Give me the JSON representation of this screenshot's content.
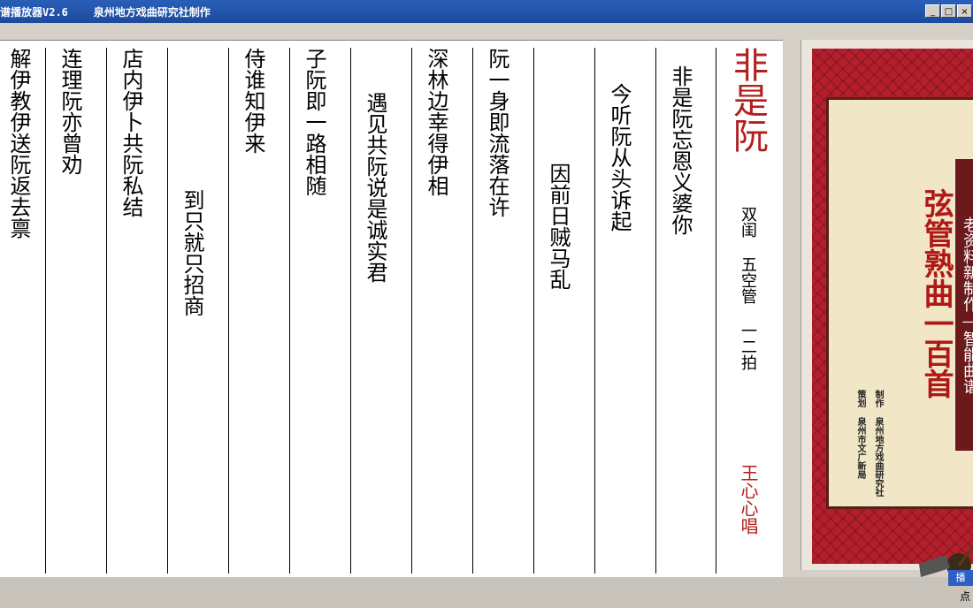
{
  "window": {
    "title": "谱播放器V2.6    泉州地方戏曲研究社制作",
    "minimize": "_",
    "maximize": "□",
    "close": "×"
  },
  "sheet": {
    "columns": [
      {
        "lyric": "解伊教伊送阮返去禀"
      },
      {
        "lyric": "连理阮亦曾劝"
      },
      {
        "lyric": "店内伊卜共阮私结"
      },
      {
        "lyric": "到只就只招商"
      },
      {
        "lyric": "侍谁知伊来"
      },
      {
        "lyric": "子阮即一路相随"
      },
      {
        "lyric": "遇见共阮说是诚实君"
      },
      {
        "lyric": "深林边幸得伊相"
      },
      {
        "lyric": "阮一身即流落在许"
      },
      {
        "lyric": "因前日贼马乱"
      },
      {
        "lyric": "今听阮从头诉起"
      },
      {
        "lyric": "非是阮忘恩义婆你"
      }
    ],
    "song": {
      "title": "非是阮",
      "meta": "双闺 五空管 一二拍",
      "singer": "王心心唱"
    }
  },
  "cover": {
    "title": "弦管熟曲一百首",
    "slogan": "老资料新制作—智能曲谱",
    "credits_left": "策划 泉州市文广新局",
    "credits_right": "制作 泉州地方戏曲研究社"
  },
  "controls": {
    "play": "播",
    "point": "点"
  }
}
